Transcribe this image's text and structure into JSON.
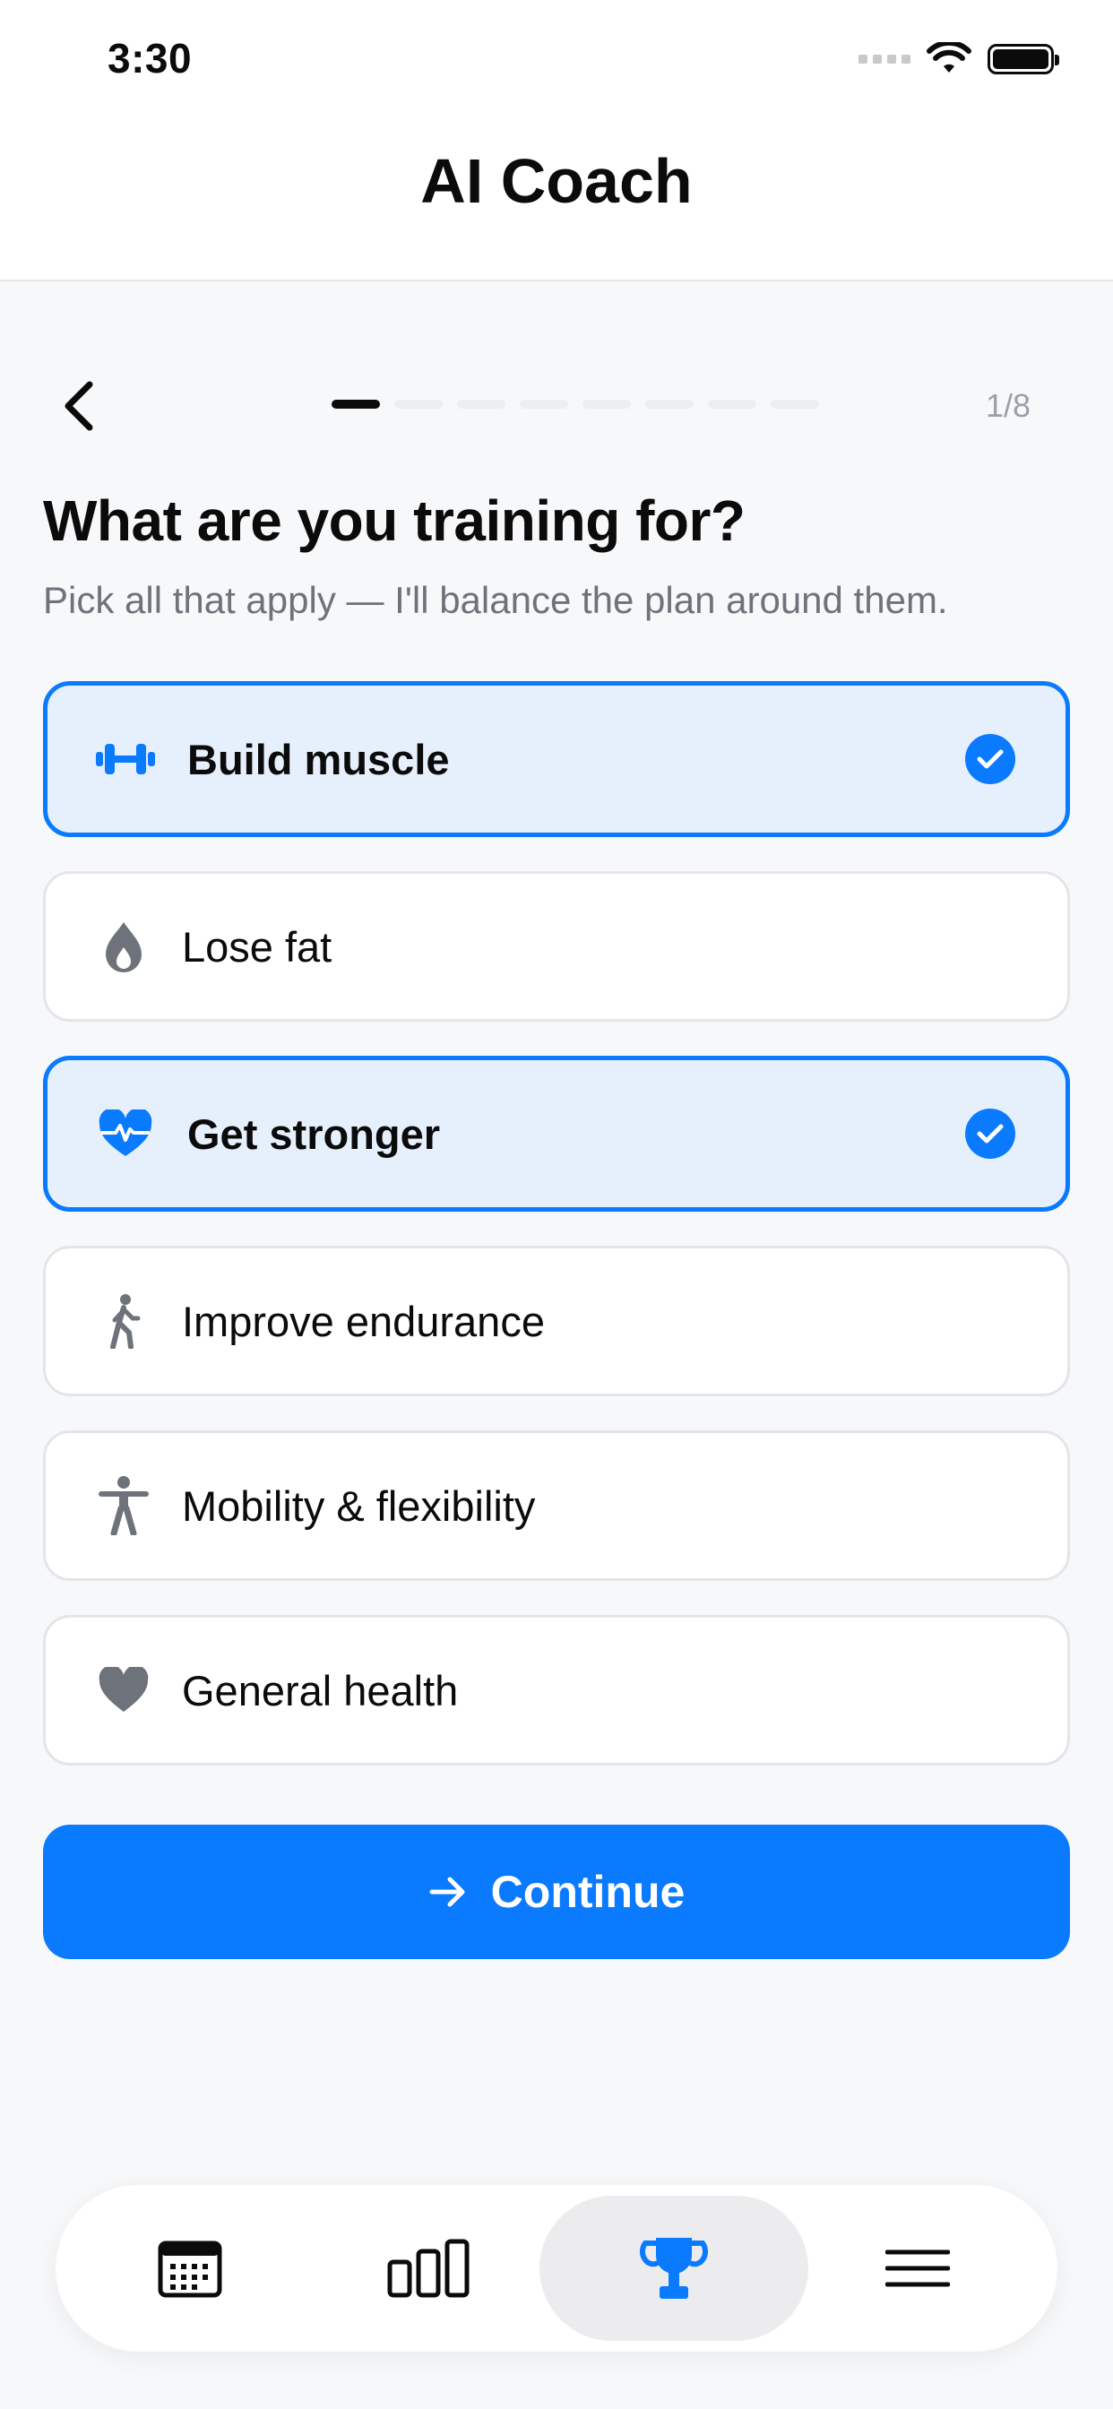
{
  "status_bar": {
    "time": "3:30"
  },
  "header": {
    "title": "AI Coach"
  },
  "progress": {
    "current_step": 1,
    "total_steps": 8,
    "label": "1/8"
  },
  "question": {
    "title": "What are you training for?",
    "subtitle": "Pick all that apply — I'll balance the plan around them."
  },
  "options": [
    {
      "label": "Build muscle",
      "icon": "dumbbell-icon",
      "selected": true
    },
    {
      "label": "Lose fat",
      "icon": "flame-drop-icon",
      "selected": false
    },
    {
      "label": "Get stronger",
      "icon": "heart-pulse-icon",
      "selected": true
    },
    {
      "label": "Improve endurance",
      "icon": "walking-figure-icon",
      "selected": false
    },
    {
      "label": "Mobility & flexibility",
      "icon": "standing-figure-icon",
      "selected": false
    },
    {
      "label": "General health",
      "icon": "heart-icon",
      "selected": false
    }
  ],
  "continue_button": {
    "label": "Continue",
    "icon": "arrow-right-icon"
  },
  "tab_bar": {
    "items": [
      {
        "icon": "calendar-icon",
        "active": false
      },
      {
        "icon": "bar-chart-icon",
        "active": false
      },
      {
        "icon": "trophy-icon",
        "active": true
      },
      {
        "icon": "menu-icon",
        "active": false
      }
    ]
  },
  "colors": {
    "accent": "#0a7aff",
    "selected_bg": "#e6f0fc",
    "muted_icon": "#6e737b",
    "background": "#f7f8fa"
  }
}
